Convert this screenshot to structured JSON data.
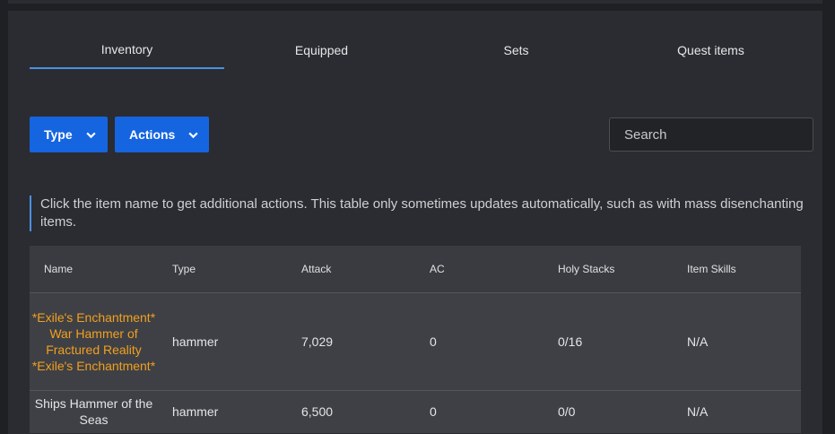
{
  "tabs": [
    {
      "label": "Inventory"
    },
    {
      "label": "Equipped"
    },
    {
      "label": "Sets"
    },
    {
      "label": "Quest items"
    }
  ],
  "toolbar": {
    "type_label": "Type",
    "actions_label": "Actions",
    "search_placeholder": "Search"
  },
  "notice": "Click the item name to get additional actions. This table only sometimes updates automatically, such as with mass disenchanting items.",
  "table": {
    "headers": [
      "Name",
      "Type",
      "Attack",
      "AC",
      "Holy Stacks",
      "Item Skills"
    ],
    "rows": [
      {
        "name": "*Exile's Enchantment* War Hammer of Fractured Reality *Exile's Enchantment*",
        "type": "hammer",
        "attack": "7,029",
        "ac": "0",
        "holy": "0/16",
        "skills": "N/A"
      },
      {
        "name": "Ships Hammer of the Seas",
        "type": "hammer",
        "attack": "6,500",
        "ac": "0",
        "holy": "0/0",
        "skills": "N/A"
      }
    ]
  },
  "colors": {
    "accent": "#1565e0",
    "tab_underline": "#4a90e2",
    "enchanted_item": "#f0a020"
  }
}
